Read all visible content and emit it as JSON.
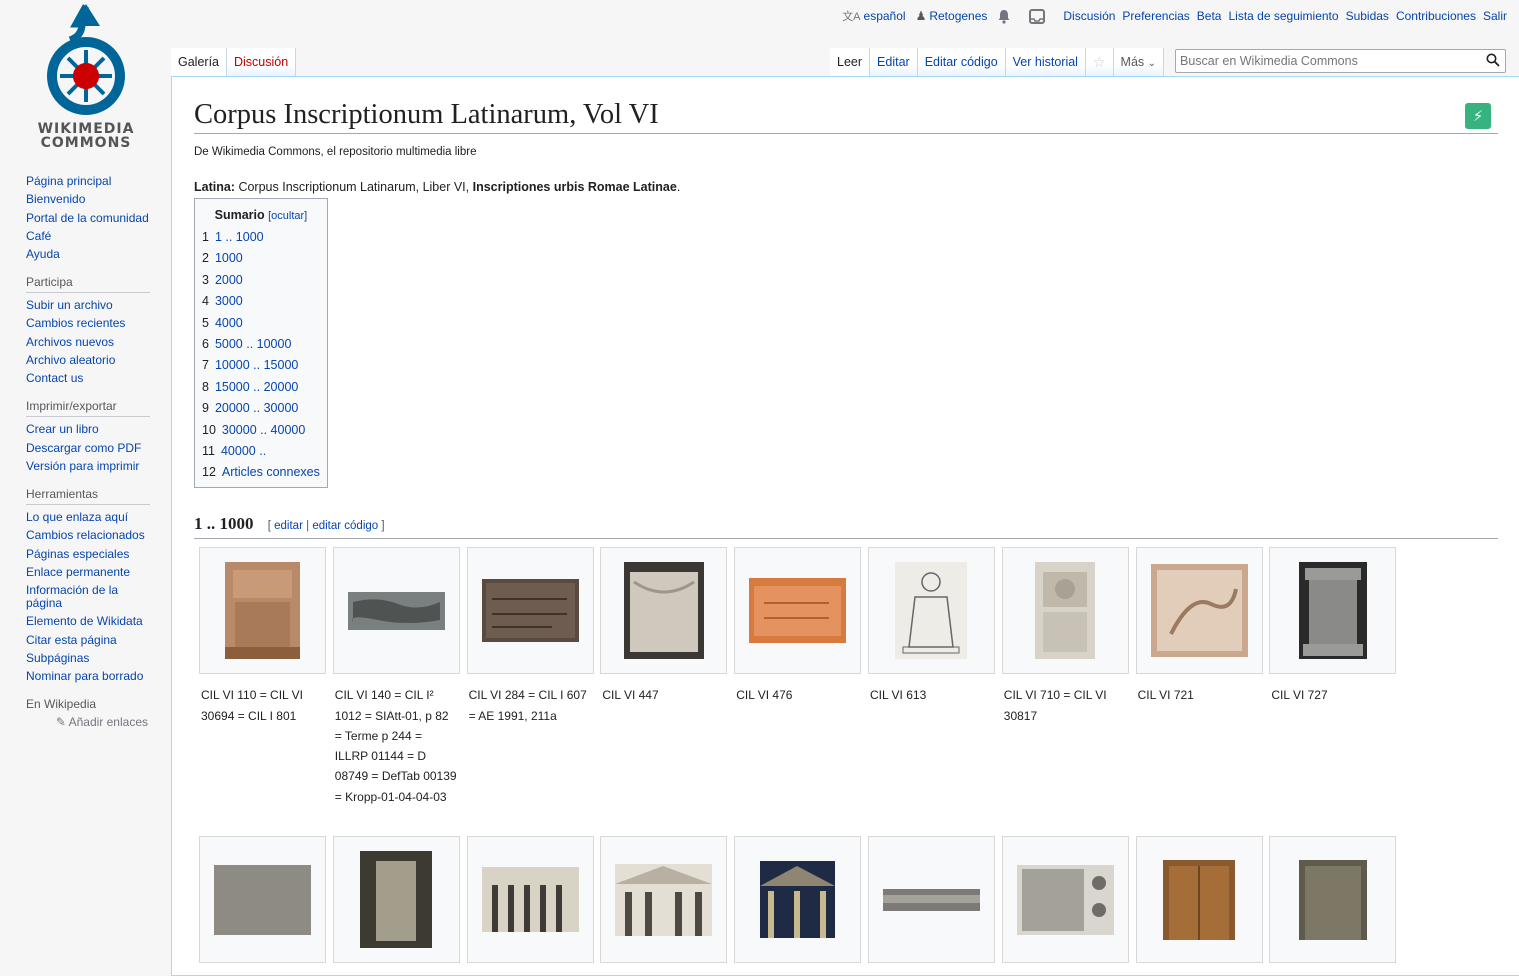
{
  "logo": {
    "line1": "WIKIMEDIA",
    "line2": "COMMONS"
  },
  "personal": {
    "language": "español",
    "user": "Retogenes",
    "links": [
      "Discusión",
      "Preferencias",
      "Beta",
      "Lista de seguimiento",
      "Subidas",
      "Contribuciones",
      "Salir"
    ]
  },
  "sidebar": {
    "nav": [
      "Página principal",
      "Bienvenido",
      "Portal de la comunidad",
      "Café",
      "Ayuda"
    ],
    "participa": {
      "heading": "Participa",
      "items": [
        "Subir un archivo",
        "Cambios recientes",
        "Archivos nuevos",
        "Archivo aleatorio",
        "Contact us"
      ]
    },
    "imprimir": {
      "heading": "Imprimir/exportar",
      "items": [
        "Crear un libro",
        "Descargar como PDF",
        "Versión para imprimir"
      ]
    },
    "herramientas": {
      "heading": "Herramientas",
      "items": [
        "Lo que enlaza aquí",
        "Cambios relacionados",
        "Páginas especiales",
        "Enlace permanente",
        "Información de la página",
        "Elemento de Wikidata",
        "Citar esta página",
        "Subpáginas",
        "Nominar para borrado"
      ]
    },
    "wikipedia": {
      "heading": "En Wikipedia",
      "add_links": "Añadir enlaces"
    }
  },
  "tabs": {
    "left": [
      "Galería",
      "Discusión"
    ],
    "right": [
      "Leer",
      "Editar",
      "Editar código",
      "Ver historial"
    ],
    "more": "Más"
  },
  "search": {
    "placeholder": "Buscar en Wikimedia Commons"
  },
  "page": {
    "title": "Corpus Inscriptionum Latinarum, Vol VI",
    "site_sub": "De Wikimedia Commons, el repositorio multimedia libre",
    "lead_label": "Latina:",
    "lead_text": " Corpus Inscriptionum Latinarum, Liber VI, ",
    "lead_bold": "Inscriptiones urbis Romae Latinae",
    "lead_end": "."
  },
  "toc": {
    "title": "Sumario",
    "hide": "[ocultar]",
    "items": [
      {
        "num": "1",
        "text": "1 .. 1000"
      },
      {
        "num": "2",
        "text": "1000"
      },
      {
        "num": "3",
        "text": "2000"
      },
      {
        "num": "4",
        "text": "3000"
      },
      {
        "num": "5",
        "text": "4000"
      },
      {
        "num": "6",
        "text": "5000 .. 10000"
      },
      {
        "num": "7",
        "text": "10000 .. 15000"
      },
      {
        "num": "8",
        "text": "15000 .. 20000"
      },
      {
        "num": "9",
        "text": "20000 .. 30000"
      },
      {
        "num": "10",
        "text": "30000 .. 40000"
      },
      {
        "num": "11",
        "text": "40000 .."
      },
      {
        "num": "12",
        "text": "Articles connexes"
      }
    ]
  },
  "section1": {
    "heading": "1 .. 1000",
    "edit_open": "[ ",
    "edit": "editar",
    "sep": " | ",
    "edit_source": "editar código",
    "edit_close": " ]"
  },
  "gallery1": [
    "CIL VI 110 = CIL VI 30694 = CIL I 801",
    "CIL VI 140 = CIL I² 1012 = SIAtt-01, p 82 = Terme p 244 = ILLRP 01144 = D 08749 = DefTab 00139 = Kropp-01-04-04-03",
    "CIL VI 284 = CIL I 607 = AE 1991, 211a",
    "CIL VI 447",
    "CIL VI 476",
    "CIL VI 613",
    "CIL VI 710 = CIL VI 30817",
    "CIL VI 721",
    "CIL VI 727"
  ],
  "colors": {
    "link": "#0645ad",
    "content_border": "#a7d7f9",
    "action_green": "#36b37e"
  }
}
